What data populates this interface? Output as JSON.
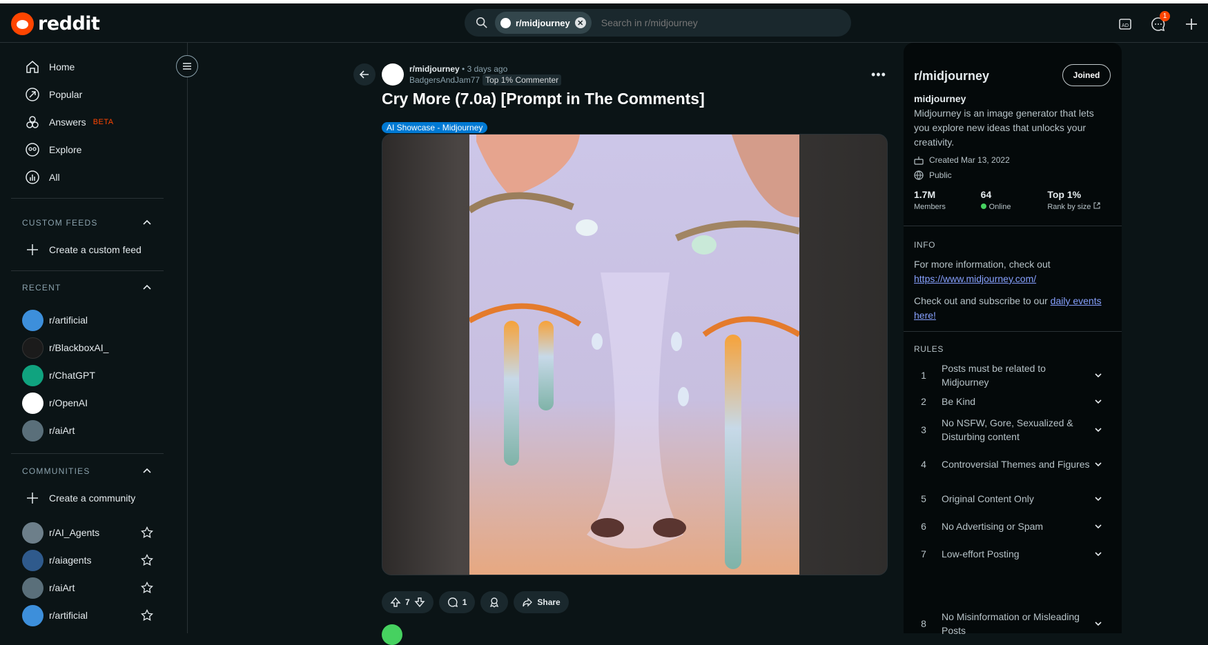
{
  "header": {
    "logo_text": "reddit",
    "search_chip": "r/midjourney",
    "search_placeholder": "Search in r/midjourney",
    "notification_count": "1"
  },
  "sidebar": {
    "nav": [
      {
        "label": "Home",
        "icon": "home-icon"
      },
      {
        "label": "Popular",
        "icon": "popular-icon"
      },
      {
        "label": "Answers",
        "icon": "answers-icon",
        "badge": "BETA"
      },
      {
        "label": "Explore",
        "icon": "explore-icon"
      },
      {
        "label": "All",
        "icon": "all-icon"
      }
    ],
    "custom_feeds": {
      "title": "CUSTOM FEEDS",
      "create": "Create a custom feed"
    },
    "recent": {
      "title": "RECENT",
      "items": [
        "r/artificial",
        "r/BlackboxAI_",
        "r/ChatGPT",
        "r/OpenAI",
        "r/aiArt"
      ]
    },
    "communities": {
      "title": "COMMUNITIES",
      "create": "Create a community",
      "items": [
        "r/AI_Agents",
        "r/aiagents",
        "r/aiArt",
        "r/artificial"
      ]
    }
  },
  "post": {
    "subreddit": "r/midjourney",
    "time": "• 3 days ago",
    "author": "BadgersAndJam77",
    "author_flair": "Top 1% Commenter",
    "title": "Cry More (7.0a) [Prompt in The Comments]",
    "flair": "AI Showcase - Midjourney",
    "votes": "7",
    "comments": "1",
    "share_label": "Share"
  },
  "rail": {
    "title": "r/midjourney",
    "joined_label": "Joined",
    "name": "midjourney",
    "description": "Midjourney is an image generator that lets you explore new ideas that unlocks your creativity.",
    "created": "Created Mar 13, 2022",
    "visibility": "Public",
    "stats": [
      {
        "value": "1.7M",
        "label": "Members"
      },
      {
        "value": "64",
        "label": "Online"
      },
      {
        "value": "Top 1%",
        "label": "Rank by size"
      }
    ],
    "info_title": "INFO",
    "info_text1": "For more information, check out",
    "info_link": "https://www.midjourney.com/",
    "info_text2": "Check out and subscribe to our",
    "info_link2a": "daily events",
    "info_link2b": "here!",
    "rules_title": "RULES",
    "rules": [
      "Posts must be related to Midjourney",
      "Be Kind",
      "No NSFW, Gore, Sexualized & Disturbing content",
      "Controversial Themes and Figures",
      "Original Content Only",
      "No Advertising or Spam",
      "Low-effort Posting",
      "No Misinformation or Misleading Posts"
    ]
  },
  "colors": {
    "accent": "#ff4500",
    "flair": "#0079d3",
    "link": "#87a1ff",
    "online": "#46d160"
  }
}
